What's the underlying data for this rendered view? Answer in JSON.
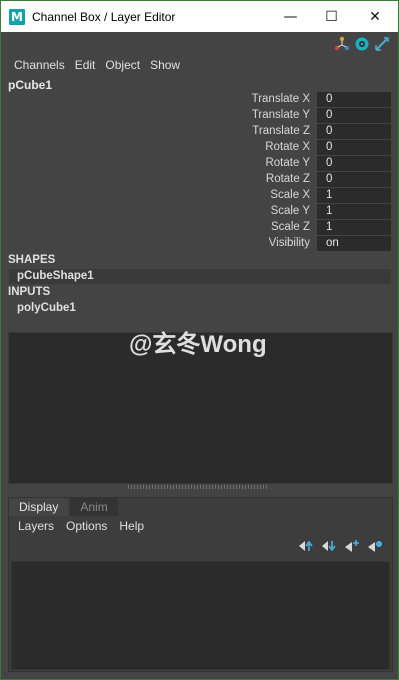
{
  "window": {
    "title": "Channel Box / Layer Editor",
    "app_icon_letter": "M",
    "controls": {
      "minimize": "—",
      "maximize": "☐",
      "close": "✕"
    }
  },
  "channel_box": {
    "top_icons": [
      "channel-box-tools-icon",
      "display-toggle-icon",
      "edit-attribute-icon"
    ],
    "menu": [
      "Channels",
      "Edit",
      "Object",
      "Show"
    ],
    "node_name": "pCube1",
    "attributes": [
      {
        "label": "Translate X",
        "value": "0"
      },
      {
        "label": "Translate Y",
        "value": "0"
      },
      {
        "label": "Translate Z",
        "value": "0"
      },
      {
        "label": "Rotate X",
        "value": "0"
      },
      {
        "label": "Rotate Y",
        "value": "0"
      },
      {
        "label": "Rotate Z",
        "value": "0"
      },
      {
        "label": "Scale X",
        "value": "1"
      },
      {
        "label": "Scale Y",
        "value": "1"
      },
      {
        "label": "Scale Z",
        "value": "1"
      },
      {
        "label": "Visibility",
        "value": "on"
      }
    ],
    "shapes_label": "SHAPES",
    "shape_item": "pCubeShape1",
    "inputs_label": "INPUTS",
    "input_item": "polyCube1"
  },
  "watermark": "@玄冬Wong",
  "layer_editor": {
    "tabs": [
      {
        "label": "Display",
        "active": true
      },
      {
        "label": "Anim",
        "active": false
      }
    ],
    "menu": [
      "Layers",
      "Options",
      "Help"
    ],
    "icons": [
      "move-layer-up-icon",
      "move-layer-down-icon",
      "new-layer-icon",
      "new-layer-selected-icon"
    ]
  },
  "colors": {
    "background": "#444444",
    "field_bg": "#2b2b2b",
    "accent_teal": "#11a3a8"
  }
}
